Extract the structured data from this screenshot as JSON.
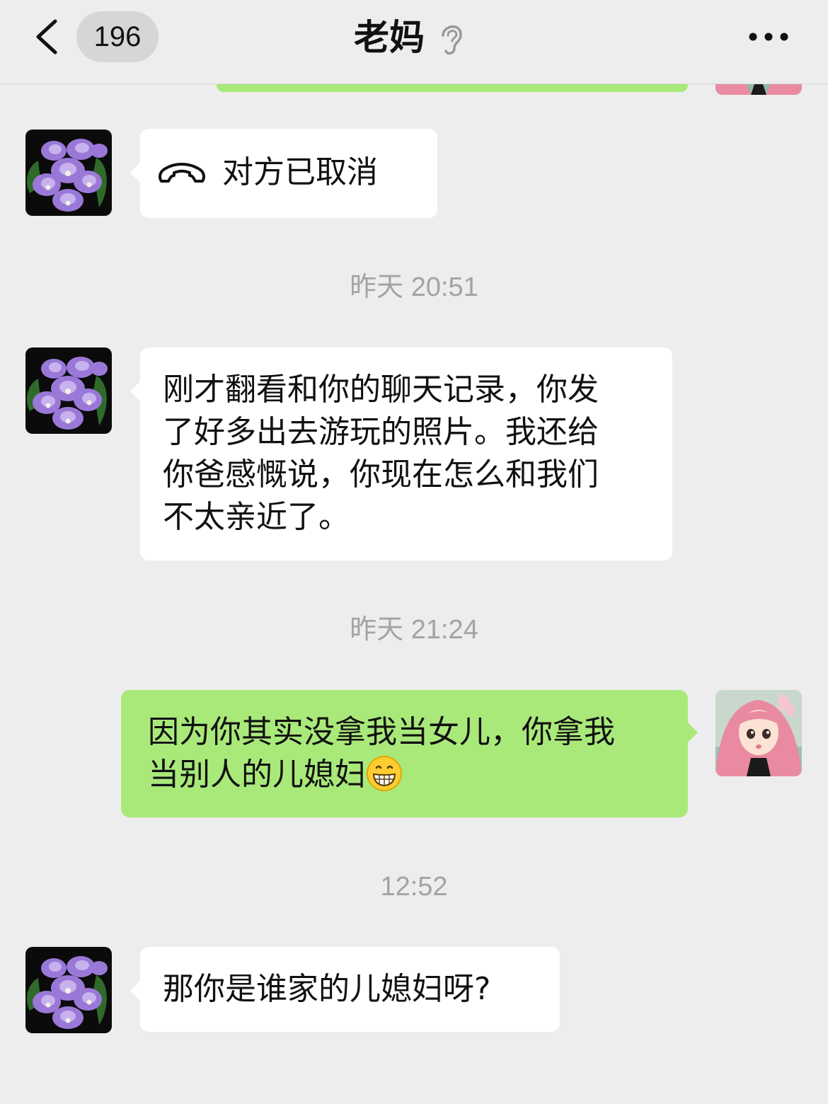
{
  "header": {
    "back_icon": "chevron-left-icon",
    "unread_count": "196",
    "title": "老妈",
    "mute_icon": "ear-icon",
    "more_icon": "more-dots-icon"
  },
  "messages": [
    {
      "type": "call",
      "side": "incoming",
      "icon": "phone-hangup-icon",
      "text": "对方已取消"
    },
    {
      "type": "timestamp",
      "text": "昨天 20:51"
    },
    {
      "type": "text",
      "side": "incoming",
      "lines": [
        "刚才翻看和你的聊天记录，你发",
        "了好多出去游玩的照片。我还给",
        "你爸感慨说，你现在怎么和我们",
        "不太亲近了。"
      ]
    },
    {
      "type": "timestamp",
      "text": "昨天 21:24"
    },
    {
      "type": "text",
      "side": "outgoing",
      "lines": [
        "因为你其实没拿我当女儿，你拿我",
        "当别人的儿媳妇"
      ],
      "emoji": "grin-emoji"
    },
    {
      "type": "timestamp",
      "text": "12:52"
    },
    {
      "type": "text",
      "side": "incoming",
      "text": "那你是谁家的儿媳妇呀?"
    }
  ],
  "colors": {
    "background": "#ededed",
    "incoming_bubble": "#ffffff",
    "outgoing_bubble": "#a9e97a",
    "timestamp_text": "#a3a3a3"
  }
}
